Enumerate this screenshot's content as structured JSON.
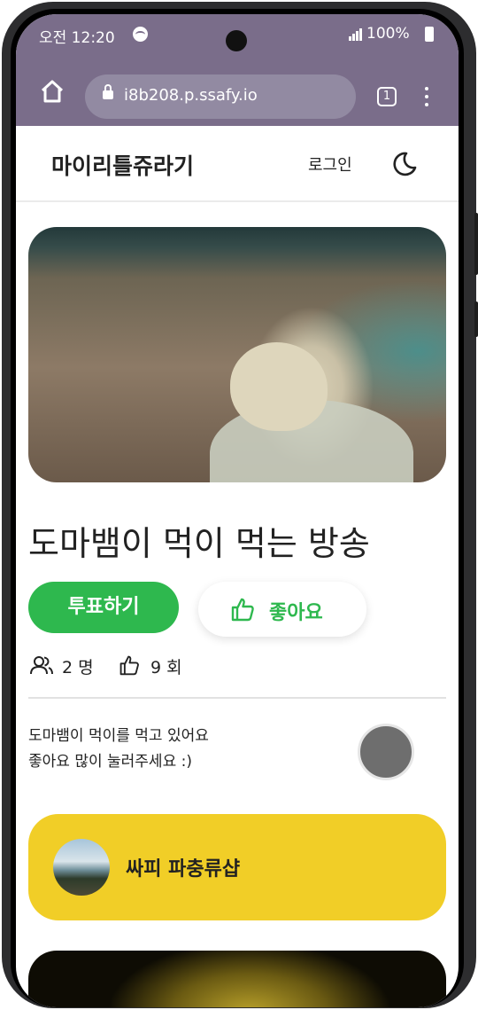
{
  "status_bar": {
    "time": "오전 12:20",
    "battery": "100%"
  },
  "browser": {
    "url": "i8b208.p.ssafy.io",
    "tab_count": "1"
  },
  "header": {
    "logo": "마이리틀쥬라기",
    "login_label": "로그인"
  },
  "stream": {
    "title": "도마뱀이 먹이 먹는 방송",
    "vote_label": "투표하기",
    "like_label": "좋아요",
    "viewer_count": "2 명",
    "like_count": "9 회",
    "description_line1": "도마뱀이 먹이를 먹고 있어요",
    "description_line2": "좋아요 많이 눌러주세요 :)"
  },
  "shop": {
    "name": "싸피 파충류샵"
  },
  "colors": {
    "accent_green": "#2eb84e",
    "shop_yellow": "#f1ce27",
    "browser_chrome": "#7a6d8a"
  },
  "icons": [
    "home-icon",
    "lock-icon",
    "tabs-icon",
    "more-vert-icon",
    "moon-icon",
    "thumbs-up-icon",
    "users-icon",
    "spotify-icon",
    "signal-icon",
    "battery-icon"
  ]
}
